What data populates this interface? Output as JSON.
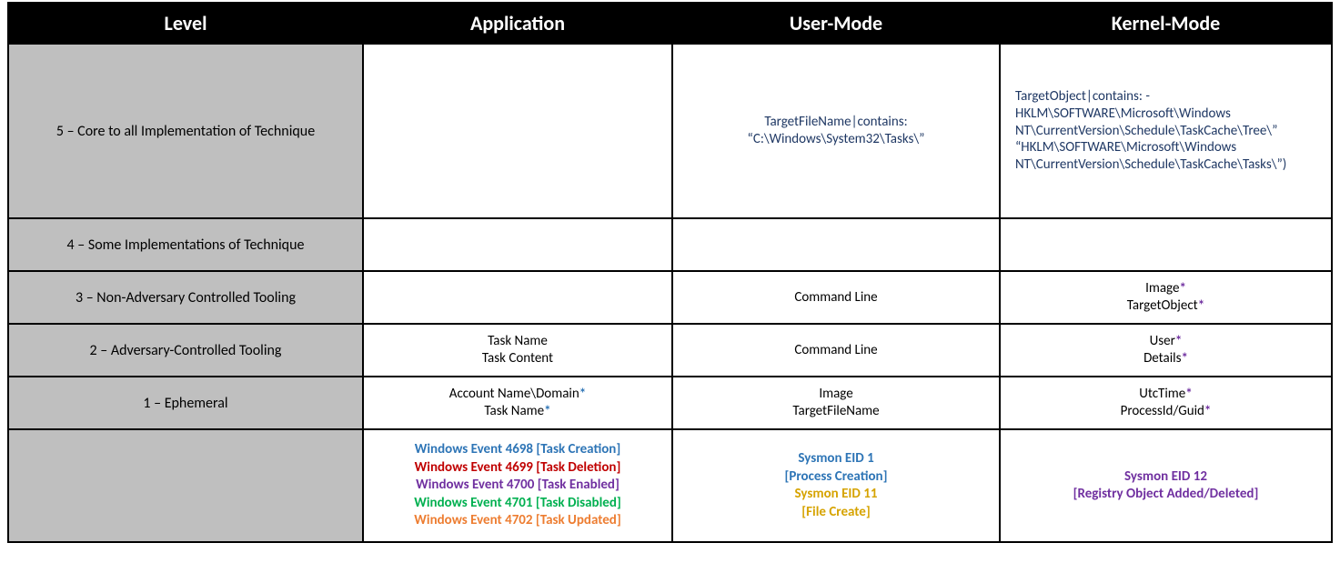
{
  "headers": {
    "level": "Level",
    "application": "Application",
    "user_mode": "User-Mode",
    "kernel_mode": "Kernel-Mode"
  },
  "rows": {
    "r5": {
      "level": "5 – Core to all Implementation of Technique",
      "application": "",
      "user_mode_l1": "TargetFileName|contains:",
      "user_mode_l2": "“C:\\Windows\\System32\\Tasks\\”",
      "kernel_mode": "TargetObject|contains: - HKLM\\SOFTWARE\\Microsoft\\Windows NT\\CurrentVersion\\Schedule\\TaskCache\\Tree\\” “HKLM\\SOFTWARE\\Microsoft\\Windows NT\\CurrentVersion\\Schedule\\TaskCache\\Tasks\\”)"
    },
    "r4": {
      "level": "4 – Some Implementations of Technique",
      "application": "",
      "user_mode": "",
      "kernel_mode": ""
    },
    "r3": {
      "level": "3 – Non-Adversary Controlled Tooling",
      "application": "",
      "user_mode": "Command Line",
      "km1": "Image",
      "km2": "TargetObject"
    },
    "r2": {
      "level": "2 – Adversary-Controlled Tooling",
      "app1": "Task Name",
      "app2": "Task Content",
      "user_mode": "Command Line",
      "km1": "User",
      "km2": "Details"
    },
    "r1": {
      "level": "1 – Ephemeral",
      "app1": "Account Name\\Domain",
      "app2": "Task Name",
      "um1": "Image",
      "um2": "TargetFileName",
      "km1": "UtcTime",
      "km2": "ProcessId/Guid"
    },
    "footer": {
      "level": "",
      "app": {
        "l1": "Windows Event 4698 [Task Creation]",
        "l2": "Windows Event 4699 [Task Deletion]",
        "l3": "Windows Event 4700 [Task Enabled]",
        "l4": "Windows Event 4701 [Task Disabled]",
        "l5": "Windows Event 4702 [Task Updated]"
      },
      "um": {
        "l1": "Sysmon EID 1",
        "l2": "[Process Creation]",
        "l3": "Sysmon EID 11",
        "l4": "[File Create]"
      },
      "km": {
        "l1": "Sysmon EID 12",
        "l2": "[Registry Object Added/Deleted]"
      }
    }
  },
  "star": "*"
}
